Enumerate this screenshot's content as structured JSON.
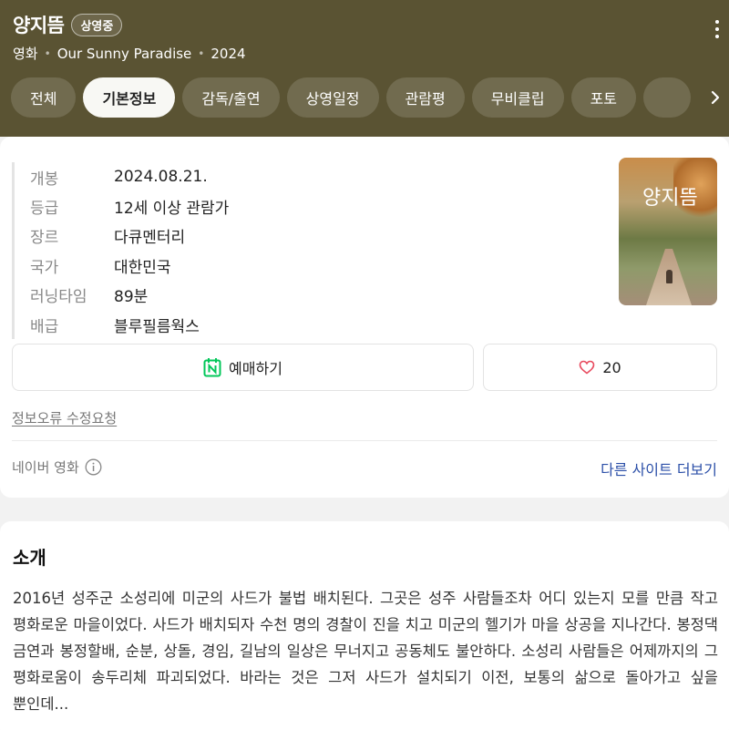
{
  "header": {
    "title": "양지뜸",
    "status_badge": "상영중",
    "category": "영화",
    "english_title": "Our Sunny Paradise",
    "year": "2024",
    "bg_color": "#5a5333"
  },
  "tabs": [
    {
      "label": "전체",
      "active": false
    },
    {
      "label": "기본정보",
      "active": true
    },
    {
      "label": "감독/출연",
      "active": false
    },
    {
      "label": "상영일정",
      "active": false
    },
    {
      "label": "관람평",
      "active": false
    },
    {
      "label": "무비클립",
      "active": false
    },
    {
      "label": "포토",
      "active": false
    }
  ],
  "info": [
    {
      "label": "개봉",
      "value": "2024.08.21."
    },
    {
      "label": "등급",
      "value": "12세 이상 관람가"
    },
    {
      "label": "장르",
      "value": "다큐멘터리"
    },
    {
      "label": "국가",
      "value": "대한민국"
    },
    {
      "label": "러닝타임",
      "value": "89분"
    },
    {
      "label": "배급",
      "value": "블루필름웍스"
    }
  ],
  "poster": {
    "title_text": "양지뜸"
  },
  "actions": {
    "book_label": "예매하기",
    "like_count": "20",
    "book_icon_color": "#03c75a",
    "like_icon_color": "#e84b5f"
  },
  "links": {
    "report": "정보오류 수정요청",
    "source": "네이버 영화",
    "more_sites": "다른 사이트 더보기"
  },
  "intro": {
    "title": "소개",
    "text": "2016년 성주군 소성리에 미군의 사드가 불법 배치된다. 그곳은 성주 사람들조차 어디 있는지 모를 만큼 작고 평화로운 마을이었다. 사드가 배치되자 수천 명의 경찰이 진을 치고 미군의 헬기가 마을 상공을 지나간다. 봉정댁 금연과 봉정할배, 순분, 상돌, 경임, 길남의 일상은 무너지고 공동체도 불안하다. 소성리 사람들은 어제까지의 그 평화로움이 송두리체 파괴되었다. 바라는 것은 그저 사드가 설치되기 이전, 보통의 삶으로 돌아가고 싶을 뿐인데..."
  }
}
